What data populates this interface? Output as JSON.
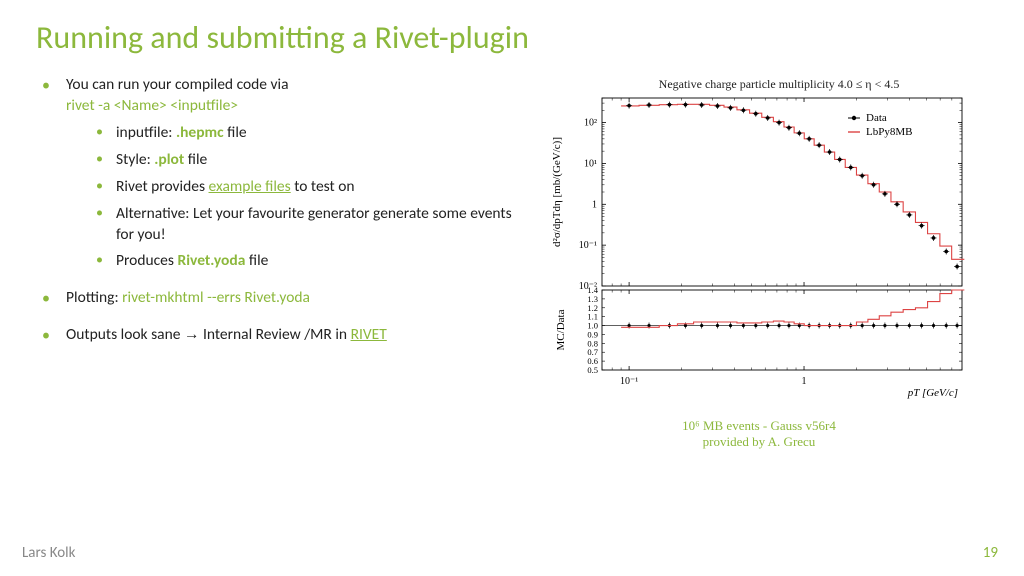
{
  "title": "Running and submitting a Rivet-plugin",
  "bullets": {
    "b1a": "You can run your compiled code via",
    "b1b": "rivet -a <Name> <inputfile>",
    "b1_1a": "inputfile: ",
    "b1_1b": ".hepmc",
    "b1_1c": " file",
    "b1_2a": "Style: ",
    "b1_2b": ".plot",
    "b1_2c": " file",
    "b1_3a": "Rivet provides ",
    "b1_3b": "example files",
    "b1_3c": " to test on",
    "b1_4": "Alternative: Let your favourite generator generate some events for you!",
    "b1_5a": "Produces ",
    "b1_5b": "Rivet.yoda",
    "b1_5c": " file",
    "b2a": "Plotting: ",
    "b2b": "rivet-mkhtml --errs Rivet.yoda",
    "b3a": "Outputs look sane ",
    "b3b": "→",
    "b3c": " Internal Review /MR in ",
    "b3d": "RIVET"
  },
  "chart_title": "Negative charge particle multiplicity 4.0 ≤ η < 4.5",
  "legend": {
    "data": "Data",
    "mc": "LbPy8MB"
  },
  "ylabel_top": "d²σ/dpTdη [mb/(GeV/c)]",
  "ylabel_bot": "MC/Data",
  "xlabel": "pT [GeV/c]",
  "caption1": "10⁶ MB events - Gauss v56r4",
  "caption2": "provided by A. Grecu",
  "footer_left": "Lars Kolk",
  "footer_right": "19",
  "chart_data": {
    "type": "line",
    "title": "Negative charge particle multiplicity 4.0 ≤ η < 4.5",
    "xlabel": "pT [GeV/c]",
    "ylabel": "d²σ/dpTdη [mb/(GeV/c)]",
    "xscale": "log",
    "yscale": "log",
    "xlim": [
      0.07,
      8
    ],
    "ylim": [
      0.01,
      400
    ],
    "series": [
      {
        "name": "Data",
        "style": "points-black",
        "x": [
          0.1,
          0.13,
          0.17,
          0.21,
          0.26,
          0.32,
          0.38,
          0.45,
          0.53,
          0.62,
          0.72,
          0.82,
          0.94,
          1.07,
          1.22,
          1.4,
          1.6,
          1.85,
          2.15,
          2.5,
          2.9,
          3.4,
          4.0,
          4.7,
          5.5,
          6.5,
          7.5
        ],
        "y": [
          260,
          270,
          275,
          275,
          270,
          255,
          230,
          200,
          165,
          130,
          100,
          75,
          55,
          40,
          28,
          19,
          12.5,
          8,
          5,
          3,
          1.8,
          1.0,
          0.55,
          0.3,
          0.15,
          0.07,
          0.03
        ]
      },
      {
        "name": "LbPy8MB",
        "style": "step-red",
        "x": [
          0.1,
          0.13,
          0.17,
          0.21,
          0.26,
          0.32,
          0.38,
          0.45,
          0.53,
          0.62,
          0.72,
          0.82,
          0.94,
          1.07,
          1.22,
          1.4,
          1.6,
          1.85,
          2.15,
          2.5,
          2.9,
          3.4,
          4.0,
          4.7,
          5.5,
          6.5,
          7.5
        ],
        "y": [
          255,
          265,
          275,
          280,
          280,
          265,
          240,
          205,
          170,
          135,
          105,
          78,
          56,
          40,
          28,
          19,
          12.5,
          8,
          5.2,
          3.2,
          2.0,
          1.15,
          0.65,
          0.36,
          0.19,
          0.095,
          0.045
        ]
      }
    ],
    "ratio_panel": {
      "ylabel": "MC/Data",
      "ylim": [
        0.5,
        1.4
      ],
      "x": [
        0.1,
        0.13,
        0.17,
        0.21,
        0.26,
        0.32,
        0.38,
        0.45,
        0.53,
        0.62,
        0.72,
        0.82,
        0.94,
        1.07,
        1.22,
        1.4,
        1.6,
        1.85,
        2.15,
        2.5,
        2.9,
        3.4,
        4.0,
        4.7,
        5.5,
        6.5,
        7.5
      ],
      "values": [
        0.98,
        0.98,
        1.0,
        1.02,
        1.04,
        1.04,
        1.04,
        1.03,
        1.03,
        1.04,
        1.05,
        1.04,
        1.02,
        1.0,
        1.0,
        1.0,
        1.0,
        1.0,
        1.04,
        1.07,
        1.11,
        1.15,
        1.18,
        1.2,
        1.27,
        1.36,
        1.5
      ]
    }
  }
}
